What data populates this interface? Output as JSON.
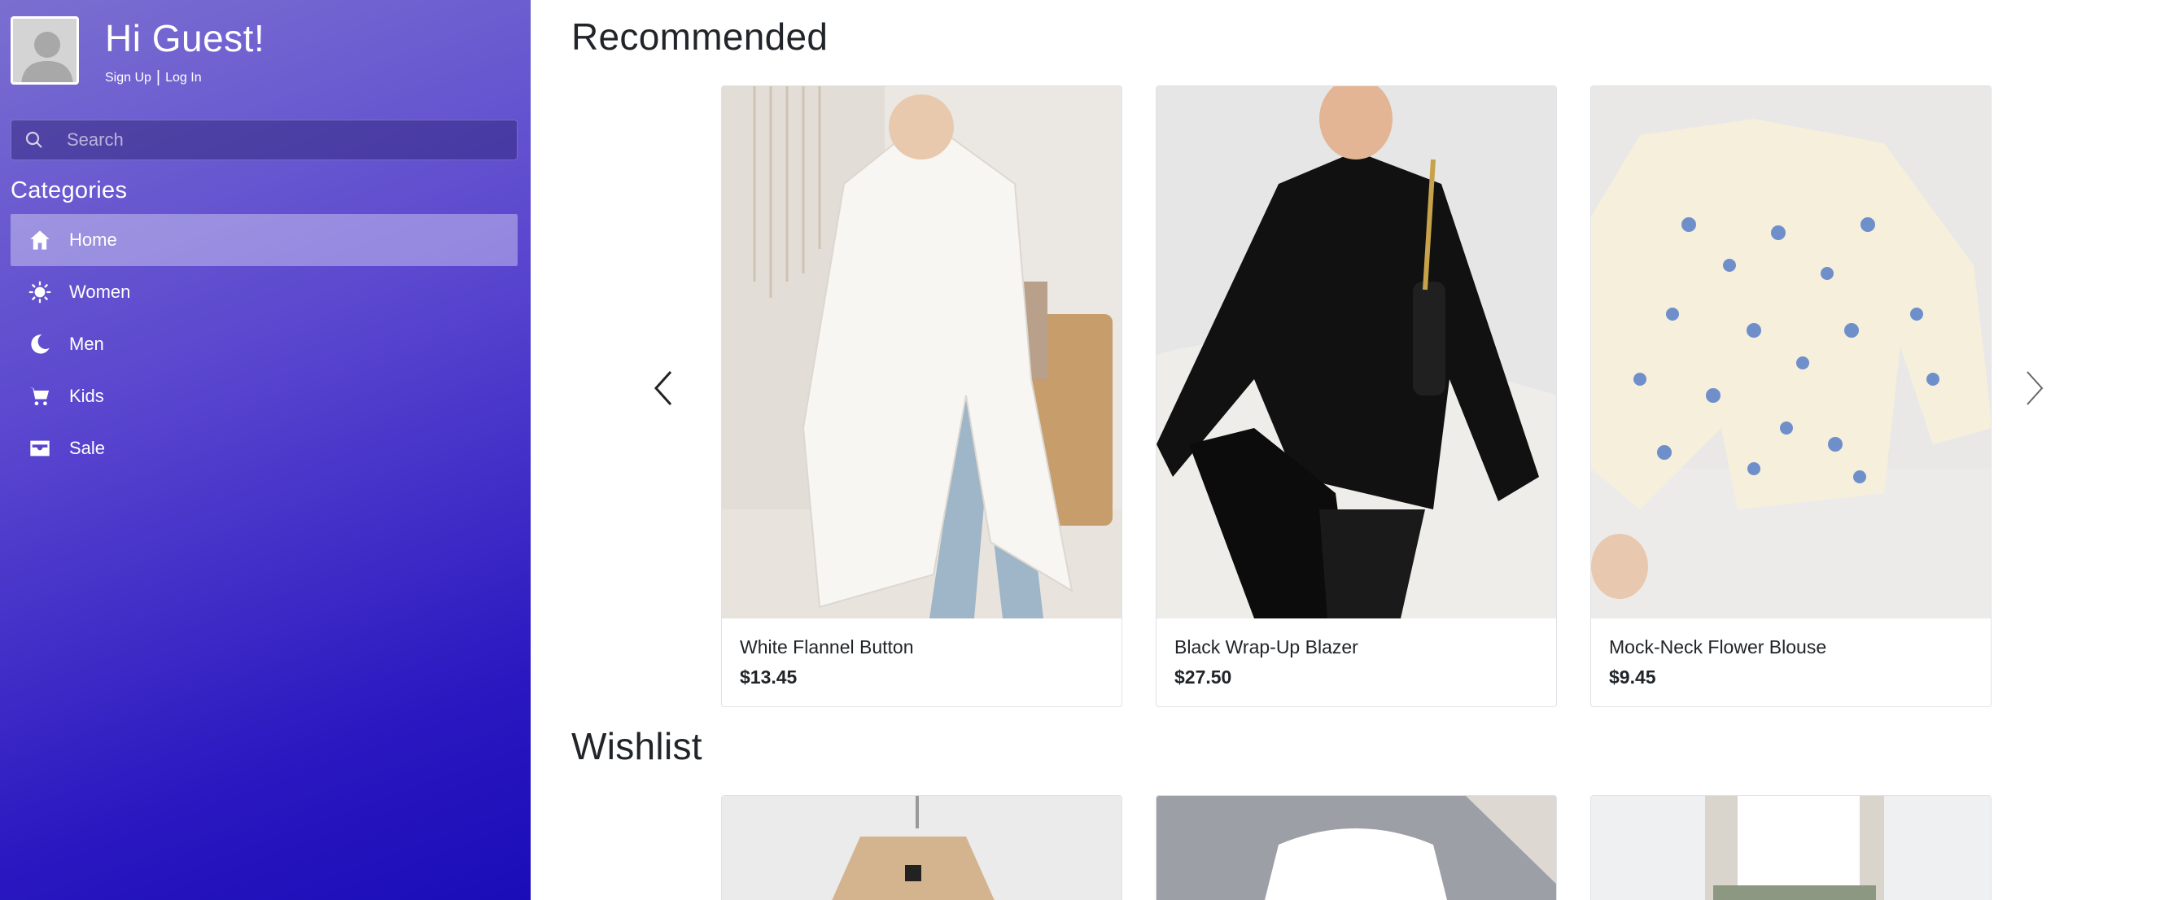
{
  "sidebar": {
    "greeting": "Hi Guest!",
    "sign_up": "Sign Up",
    "separator": "|",
    "log_in": "Log In",
    "search_placeholder": "Search",
    "categories_title": "Categories",
    "items": [
      {
        "label": "Home",
        "icon": "home-icon",
        "active": true
      },
      {
        "label": "Women",
        "icon": "sun-icon",
        "active": false
      },
      {
        "label": "Men",
        "icon": "moon-icon",
        "active": false
      },
      {
        "label": "Kids",
        "icon": "cart-icon",
        "active": false
      },
      {
        "label": "Sale",
        "icon": "inbox-icon",
        "active": false
      }
    ]
  },
  "main": {
    "recommended_title": "Recommended",
    "wishlist_title": "Wishlist",
    "recommended": [
      {
        "name": "White Flannel Button",
        "price": "$13.45"
      },
      {
        "name": "Black Wrap-Up Blazer",
        "price": "$27.50"
      },
      {
        "name": "Mock-Neck Flower Blouse",
        "price": "$9.45"
      }
    ]
  },
  "colors": {
    "sidebar_gradient_start": "#7a6fd0",
    "sidebar_gradient_end": "#1a0db8",
    "text": "#212529"
  }
}
